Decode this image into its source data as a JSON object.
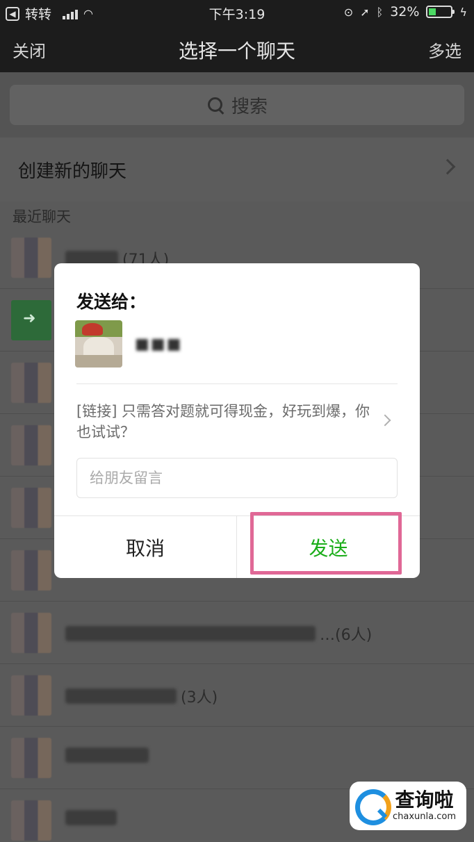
{
  "status_bar": {
    "carrier": "转转",
    "time": "下午3:19",
    "battery_percent": "32%",
    "battery_level": 0.32,
    "battery_color": "#4cd964"
  },
  "nav": {
    "close_label": "关闭",
    "title": "选择一个聊天",
    "multi_select_label": "多选"
  },
  "search": {
    "placeholder": "搜索",
    "icon": "search-icon"
  },
  "new_chat": {
    "label": "创建新的聊天",
    "icon": "chevron-right-icon"
  },
  "recent": {
    "section_label": "最近聊天",
    "rows": [
      {
        "count": "(71人)"
      },
      {
        "count": ""
      },
      {
        "count": ""
      },
      {
        "count": ""
      },
      {
        "count": ""
      },
      {
        "count": ""
      },
      {
        "count": "…(6人)"
      },
      {
        "count": "(3人)"
      },
      {
        "count": ""
      },
      {
        "count": ""
      }
    ]
  },
  "dialog": {
    "title": "发送给：",
    "link_text": "[链接] 只需答对题就可得现金，好玩到爆，你也试试？",
    "message_placeholder": "给朋友留言",
    "cancel_label": "取消",
    "send_label": "发送",
    "send_color": "#1aad19"
  },
  "highlight": {
    "color": "#e06896"
  },
  "watermark": {
    "text_cn": "查询啦",
    "text_en": "chaxunla.com"
  }
}
